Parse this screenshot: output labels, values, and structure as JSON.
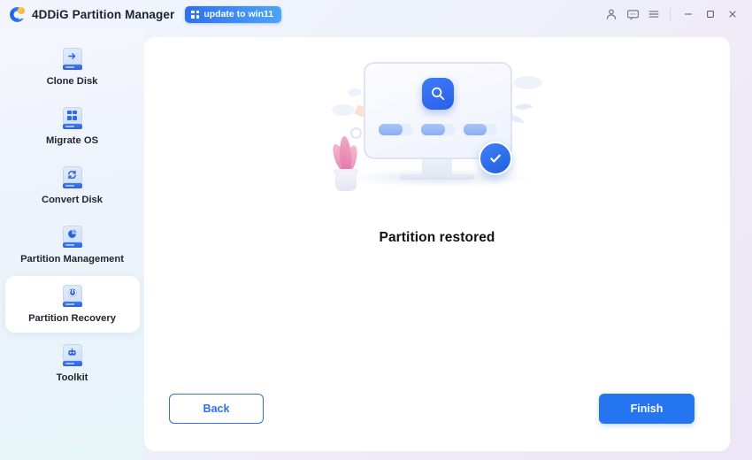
{
  "window": {
    "app_title": "4DDiG Partition Manager",
    "update_badge": {
      "label": "update to win11",
      "icon": "windows-grid-icon"
    },
    "logo_icon": "4ddig-logo-icon",
    "right_icons": [
      {
        "name": "account-icon",
        "glyph": "person"
      },
      {
        "name": "feedback-icon",
        "glyph": "chat"
      },
      {
        "name": "menu-icon",
        "glyph": "hamburger"
      }
    ],
    "controls": [
      {
        "name": "minimize-button",
        "glyph": "minimize"
      },
      {
        "name": "maximize-button",
        "glyph": "maximize"
      },
      {
        "name": "close-button",
        "glyph": "close"
      }
    ]
  },
  "sidebar": {
    "items": [
      {
        "label": "Clone Disk",
        "icon": "clone-disk-icon",
        "active": false
      },
      {
        "label": "Migrate OS",
        "icon": "migrate-os-icon",
        "active": false
      },
      {
        "label": "Convert Disk",
        "icon": "convert-disk-icon",
        "active": false
      },
      {
        "label": "Partition Management",
        "icon": "partition-management-icon",
        "active": false
      },
      {
        "label": "Partition Recovery",
        "icon": "partition-recovery-icon",
        "active": true
      },
      {
        "label": "Toolkit",
        "icon": "toolkit-icon",
        "active": false
      }
    ]
  },
  "main": {
    "status_title": "Partition restored",
    "illustration": {
      "name": "partition-restored-illustration",
      "monitor_icon": "search-magnifier-icon",
      "badge_icon": "check-circle-icon",
      "progress_bars": [
        70,
        72,
        68
      ]
    },
    "buttons": {
      "back_label": "Back",
      "finish_label": "Finish"
    }
  },
  "colors": {
    "accent_blue": "#2574f0",
    "badge_blue": "#2f6ff0",
    "sidebar_start": "#f4f6fd",
    "sidebar_end": "#e6f5f8",
    "text_dark": "#101217"
  }
}
